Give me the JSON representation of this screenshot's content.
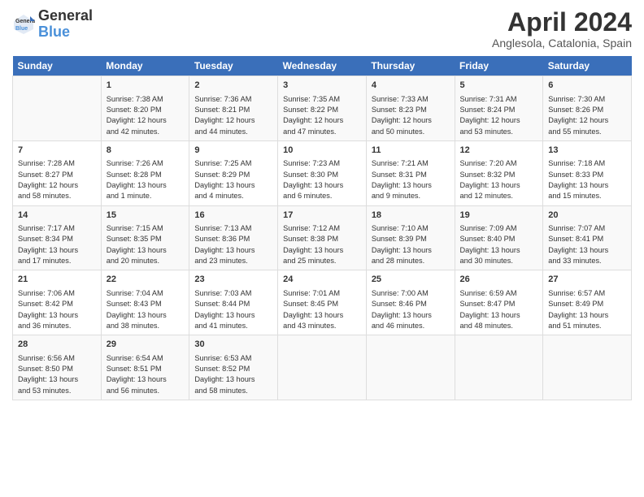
{
  "header": {
    "logo_line1": "General",
    "logo_line2": "Blue",
    "title": "April 2024",
    "subtitle": "Anglesola, Catalonia, Spain"
  },
  "columns": [
    "Sunday",
    "Monday",
    "Tuesday",
    "Wednesday",
    "Thursday",
    "Friday",
    "Saturday"
  ],
  "weeks": [
    {
      "cells": [
        {
          "day": "",
          "content": ""
        },
        {
          "day": "1",
          "content": "Sunrise: 7:38 AM\nSunset: 8:20 PM\nDaylight: 12 hours\nand 42 minutes."
        },
        {
          "day": "2",
          "content": "Sunrise: 7:36 AM\nSunset: 8:21 PM\nDaylight: 12 hours\nand 44 minutes."
        },
        {
          "day": "3",
          "content": "Sunrise: 7:35 AM\nSunset: 8:22 PM\nDaylight: 12 hours\nand 47 minutes."
        },
        {
          "day": "4",
          "content": "Sunrise: 7:33 AM\nSunset: 8:23 PM\nDaylight: 12 hours\nand 50 minutes."
        },
        {
          "day": "5",
          "content": "Sunrise: 7:31 AM\nSunset: 8:24 PM\nDaylight: 12 hours\nand 53 minutes."
        },
        {
          "day": "6",
          "content": "Sunrise: 7:30 AM\nSunset: 8:26 PM\nDaylight: 12 hours\nand 55 minutes."
        }
      ]
    },
    {
      "cells": [
        {
          "day": "7",
          "content": "Sunrise: 7:28 AM\nSunset: 8:27 PM\nDaylight: 12 hours\nand 58 minutes."
        },
        {
          "day": "8",
          "content": "Sunrise: 7:26 AM\nSunset: 8:28 PM\nDaylight: 13 hours\nand 1 minute."
        },
        {
          "day": "9",
          "content": "Sunrise: 7:25 AM\nSunset: 8:29 PM\nDaylight: 13 hours\nand 4 minutes."
        },
        {
          "day": "10",
          "content": "Sunrise: 7:23 AM\nSunset: 8:30 PM\nDaylight: 13 hours\nand 6 minutes."
        },
        {
          "day": "11",
          "content": "Sunrise: 7:21 AM\nSunset: 8:31 PM\nDaylight: 13 hours\nand 9 minutes."
        },
        {
          "day": "12",
          "content": "Sunrise: 7:20 AM\nSunset: 8:32 PM\nDaylight: 13 hours\nand 12 minutes."
        },
        {
          "day": "13",
          "content": "Sunrise: 7:18 AM\nSunset: 8:33 PM\nDaylight: 13 hours\nand 15 minutes."
        }
      ]
    },
    {
      "cells": [
        {
          "day": "14",
          "content": "Sunrise: 7:17 AM\nSunset: 8:34 PM\nDaylight: 13 hours\nand 17 minutes."
        },
        {
          "day": "15",
          "content": "Sunrise: 7:15 AM\nSunset: 8:35 PM\nDaylight: 13 hours\nand 20 minutes."
        },
        {
          "day": "16",
          "content": "Sunrise: 7:13 AM\nSunset: 8:36 PM\nDaylight: 13 hours\nand 23 minutes."
        },
        {
          "day": "17",
          "content": "Sunrise: 7:12 AM\nSunset: 8:38 PM\nDaylight: 13 hours\nand 25 minutes."
        },
        {
          "day": "18",
          "content": "Sunrise: 7:10 AM\nSunset: 8:39 PM\nDaylight: 13 hours\nand 28 minutes."
        },
        {
          "day": "19",
          "content": "Sunrise: 7:09 AM\nSunset: 8:40 PM\nDaylight: 13 hours\nand 30 minutes."
        },
        {
          "day": "20",
          "content": "Sunrise: 7:07 AM\nSunset: 8:41 PM\nDaylight: 13 hours\nand 33 minutes."
        }
      ]
    },
    {
      "cells": [
        {
          "day": "21",
          "content": "Sunrise: 7:06 AM\nSunset: 8:42 PM\nDaylight: 13 hours\nand 36 minutes."
        },
        {
          "day": "22",
          "content": "Sunrise: 7:04 AM\nSunset: 8:43 PM\nDaylight: 13 hours\nand 38 minutes."
        },
        {
          "day": "23",
          "content": "Sunrise: 7:03 AM\nSunset: 8:44 PM\nDaylight: 13 hours\nand 41 minutes."
        },
        {
          "day": "24",
          "content": "Sunrise: 7:01 AM\nSunset: 8:45 PM\nDaylight: 13 hours\nand 43 minutes."
        },
        {
          "day": "25",
          "content": "Sunrise: 7:00 AM\nSunset: 8:46 PM\nDaylight: 13 hours\nand 46 minutes."
        },
        {
          "day": "26",
          "content": "Sunrise: 6:59 AM\nSunset: 8:47 PM\nDaylight: 13 hours\nand 48 minutes."
        },
        {
          "day": "27",
          "content": "Sunrise: 6:57 AM\nSunset: 8:49 PM\nDaylight: 13 hours\nand 51 minutes."
        }
      ]
    },
    {
      "cells": [
        {
          "day": "28",
          "content": "Sunrise: 6:56 AM\nSunset: 8:50 PM\nDaylight: 13 hours\nand 53 minutes."
        },
        {
          "day": "29",
          "content": "Sunrise: 6:54 AM\nSunset: 8:51 PM\nDaylight: 13 hours\nand 56 minutes."
        },
        {
          "day": "30",
          "content": "Sunrise: 6:53 AM\nSunset: 8:52 PM\nDaylight: 13 hours\nand 58 minutes."
        },
        {
          "day": "",
          "content": ""
        },
        {
          "day": "",
          "content": ""
        },
        {
          "day": "",
          "content": ""
        },
        {
          "day": "",
          "content": ""
        }
      ]
    }
  ]
}
